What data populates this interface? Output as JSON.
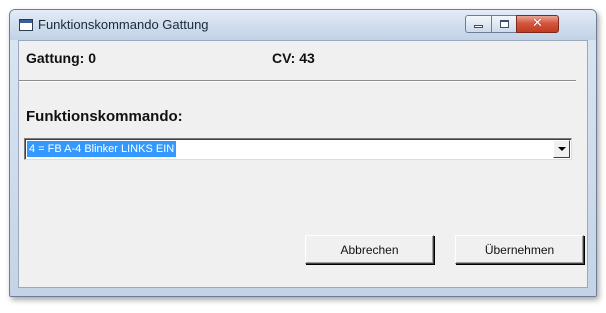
{
  "window": {
    "title": "Funktionskommando Gattung",
    "title_icon": "window-icon",
    "controls": {
      "minimize_icon": "minimize-icon",
      "maximize_icon": "maximize-icon",
      "close_icon": "close-icon",
      "close_glyph": "✕"
    }
  },
  "info": {
    "gattung": "Gattung: 0",
    "cv": "CV: 43"
  },
  "form": {
    "label": "Funktionskommando:",
    "selected_value": "4 = FB A-4 Blinker LINKS EIN",
    "dropdown_icon": "chevron-down-icon"
  },
  "buttons": {
    "cancel": "Abbrechen",
    "apply": "Übernehmen"
  },
  "colors": {
    "selection": "#3399ff",
    "close_button": "#c23a22"
  }
}
